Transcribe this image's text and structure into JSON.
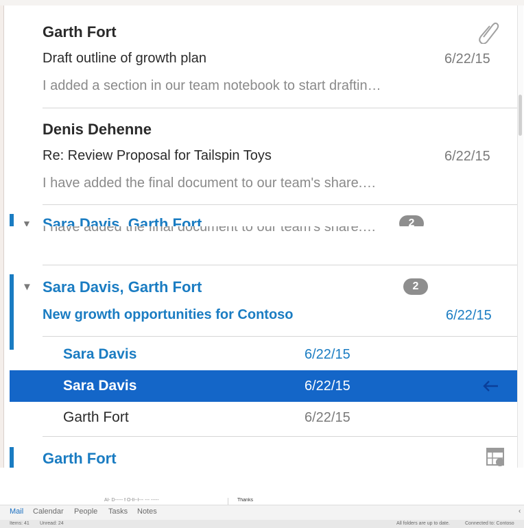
{
  "top_list": {
    "messages": [
      {
        "sender": "Garth Fort",
        "subject": "Draft outline of growth plan",
        "date": "6/22/15",
        "preview": "I added a section in our team notebook to start draftin…",
        "icon": "paperclip-icon"
      },
      {
        "sender": "Denis Dehenne",
        "subject": "Re: Review Proposal for Tailspin Toys",
        "date": "6/22/15",
        "preview": "I have added the final document to our team's share.…"
      }
    ],
    "cut_thread": {
      "title": "Sara Davis, Garth Fort",
      "badge": "2"
    }
  },
  "zoom_list": {
    "cut_preview": "I have added the final document to our team's share.…",
    "thread": {
      "title": "Sara Davis, Garth Fort",
      "count": "2",
      "subject": "New growth opportunities for Contoso",
      "date": "6/22/15",
      "items": [
        {
          "name": "Sara Davis",
          "date": "6/22/15"
        },
        {
          "name": "Sara Davis",
          "date": "6/22/15",
          "selected": true,
          "icon": "reply-arrow-icon"
        },
        {
          "name": "Garth Fort",
          "date": "6/22/15"
        }
      ]
    },
    "next_sender": "Garth Fort",
    "next_icon": "calendar-icon"
  },
  "background": {
    "snippet_left": "Al- D----- f O-ll--l---  --- -----",
    "snippet_right": "Thanks"
  },
  "nav_tabs": [
    "Mail",
    "Calendar",
    "People",
    "Tasks",
    "Notes"
  ],
  "status_bar": {
    "items": "Items: 41",
    "unread": "Unread: 24",
    "sync": "All folders are up to date.",
    "connection": "Connected to: Contoso"
  },
  "colors": {
    "accent": "#1a7cc2",
    "selected": "#1466c8",
    "badge": "#8e8e8e"
  }
}
